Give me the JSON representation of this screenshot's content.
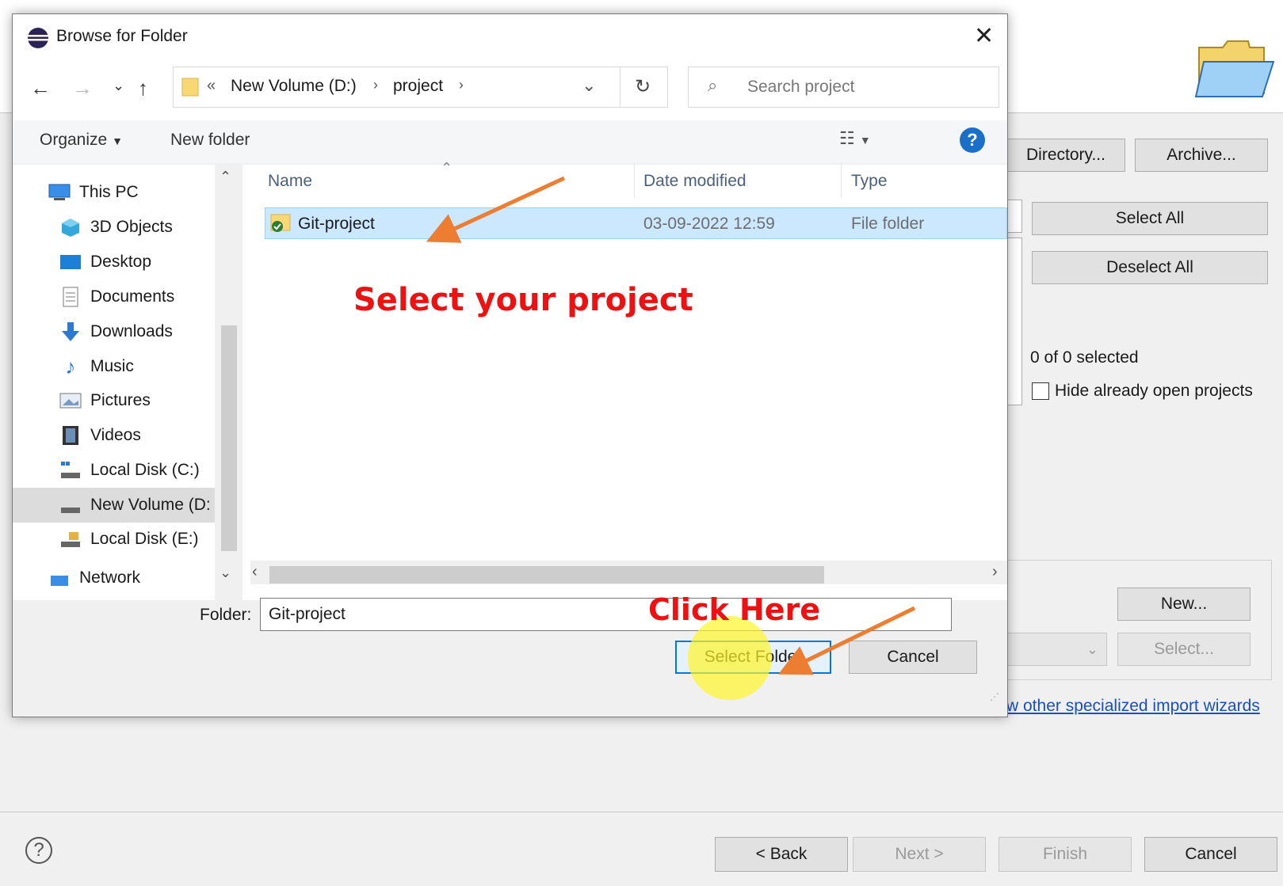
{
  "wizard": {
    "buttons": {
      "directory": "Directory...",
      "archive": "Archive...",
      "select_all": "Select All",
      "deselect_all": "Deselect All",
      "new": "New...",
      "select": "Select..."
    },
    "selected_count": "0 of 0 selected",
    "hide_open_label": "Hide already open projects",
    "link_text": "w other specialized import wizards",
    "footer": {
      "back": "< Back",
      "next": "Next >",
      "finish": "Finish",
      "cancel": "Cancel"
    }
  },
  "dialog": {
    "title": "Browse for Folder",
    "address": {
      "prefix": "«",
      "segments": [
        "New Volume (D:)",
        "project"
      ]
    },
    "search_placeholder": "Search project",
    "toolbar": {
      "organize": "Organize",
      "new_folder": "New folder"
    },
    "nav_items": [
      {
        "label": "This PC",
        "icon": "pc-icon"
      },
      {
        "label": "3D Objects",
        "icon": "cube-icon"
      },
      {
        "label": "Desktop",
        "icon": "desktop-icon"
      },
      {
        "label": "Documents",
        "icon": "document-icon"
      },
      {
        "label": "Downloads",
        "icon": "download-icon"
      },
      {
        "label": "Music",
        "icon": "music-icon"
      },
      {
        "label": "Pictures",
        "icon": "pictures-icon"
      },
      {
        "label": "Videos",
        "icon": "video-icon"
      },
      {
        "label": "Local Disk (C:)",
        "icon": "disk-icon"
      },
      {
        "label": "New Volume (D:",
        "icon": "disk-icon"
      },
      {
        "label": "Local Disk (E:)",
        "icon": "locked-disk-icon"
      },
      {
        "label": "Network",
        "icon": "network-icon"
      }
    ],
    "columns": {
      "name": "Name",
      "date": "Date modified",
      "type": "Type"
    },
    "files": [
      {
        "name": "Git-project",
        "date": "03-09-2022 12:59",
        "type": "File folder"
      }
    ],
    "folder_label": "Folder:",
    "folder_value": "Git-project",
    "select_folder": "Select Folder",
    "cancel": "Cancel"
  },
  "annotations": {
    "select_project": "Select your project",
    "click_here": "Click Here",
    "arrow_color": "#ed7d31"
  },
  "colors": {
    "selection": "#cce8ff",
    "accent": "#0078d7",
    "annotation_text": "#ee1111"
  }
}
